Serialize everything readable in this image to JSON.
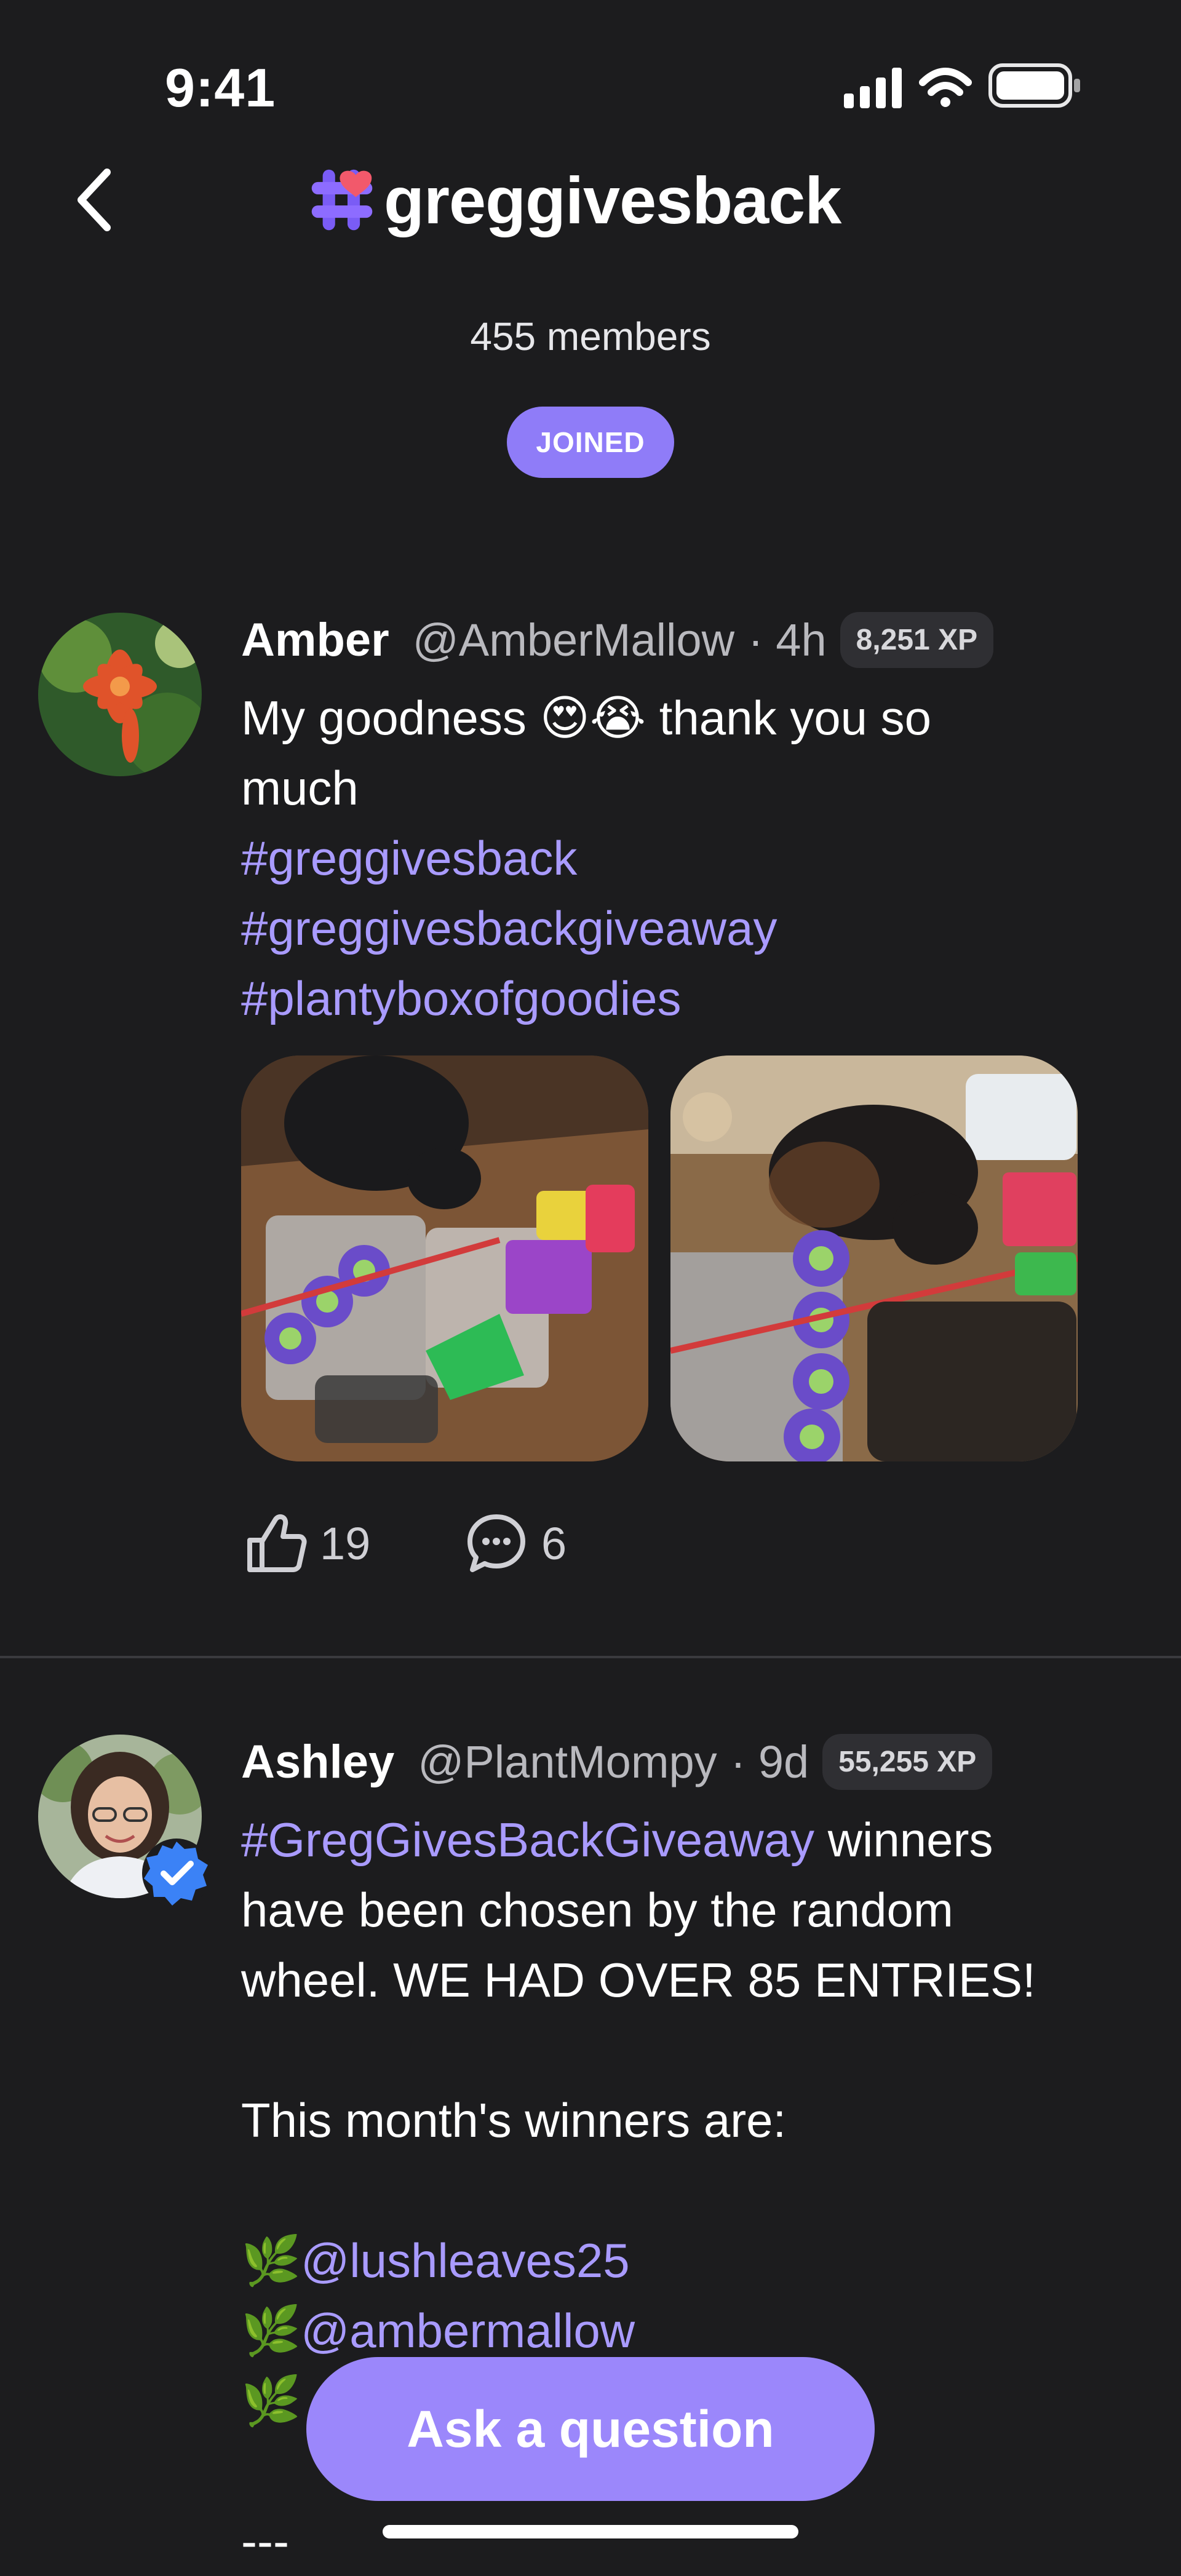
{
  "status_bar": {
    "time": "9:41"
  },
  "header": {
    "title": "greggivesback",
    "members": "455 members",
    "joined_label": "JOINED"
  },
  "posts": [
    {
      "author": "Amber",
      "handle": "@AmberMallow",
      "time": "· 4h",
      "xp": "8,251 XP",
      "text_before": "My goodness",
      "emoji": "😍😭",
      "text_after": "thank you so",
      "text_line2": "much",
      "hashtags": [
        "#greggivesback",
        "#greggivesbackgiveaway",
        "#plantyboxofgoodies"
      ],
      "likes": "19",
      "comments": "6"
    },
    {
      "author": "Ashley",
      "handle": "@PlantMompy",
      "time": "· 9d",
      "xp": "55,255 XP",
      "hashtag": "#GregGivesBackGiveaway",
      "text_l1": "winners",
      "text_l2": "have been chosen by the random",
      "text_l3": "wheel.  WE HAD OVER 85 ENTRIES!",
      "text_l4": "This month's winners are:",
      "leaf": "🌿",
      "mentions": [
        "@lushleaves25",
        "@ambermallow"
      ],
      "separator": "---"
    }
  ],
  "ask_button": "Ask a question",
  "colors": {
    "background": "#1c1c1e",
    "accent": "#8f7cf8",
    "link": "#a99bff"
  }
}
